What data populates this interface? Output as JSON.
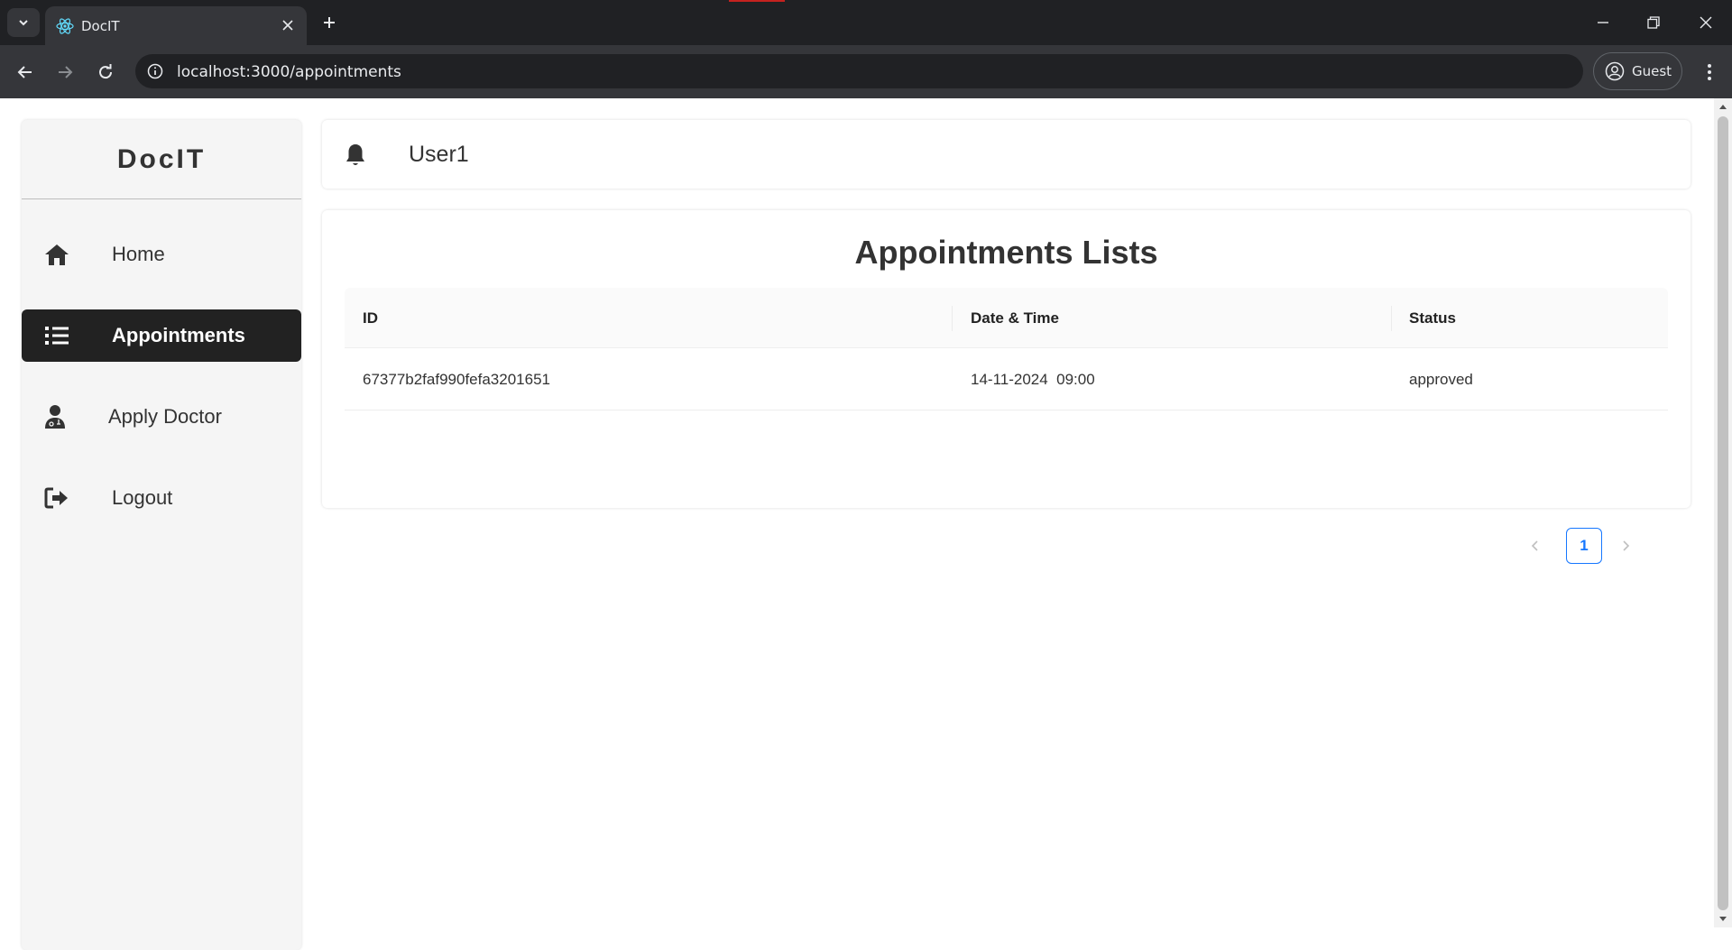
{
  "browser": {
    "tab_title": "DocIT",
    "url": "localhost:3000/appointments",
    "profile_label": "Guest"
  },
  "sidebar": {
    "brand": "DocIT",
    "items": [
      {
        "label": "Home",
        "icon": "home-icon",
        "active": false
      },
      {
        "label": "Appointments",
        "icon": "list-icon",
        "active": true
      },
      {
        "label": "Apply Doctor",
        "icon": "doctor-icon",
        "active": false
      },
      {
        "label": "Logout",
        "icon": "logout-icon",
        "active": false
      }
    ]
  },
  "header": {
    "username": "User1",
    "icon": "bell-icon"
  },
  "main": {
    "title": "Appointments Lists",
    "columns": [
      "ID",
      "Date & Time",
      "Status"
    ],
    "rows": [
      {
        "id": "67377b2faf990fefa3201651",
        "datetime": "14-11-2024  09:00",
        "status": "approved"
      }
    ],
    "pagination": {
      "current_page": "1"
    }
  },
  "colors": {
    "active_item_bg": "#222222",
    "pagination_accent": "#1677ff",
    "sidebar_bg": "#f5f5f5"
  }
}
